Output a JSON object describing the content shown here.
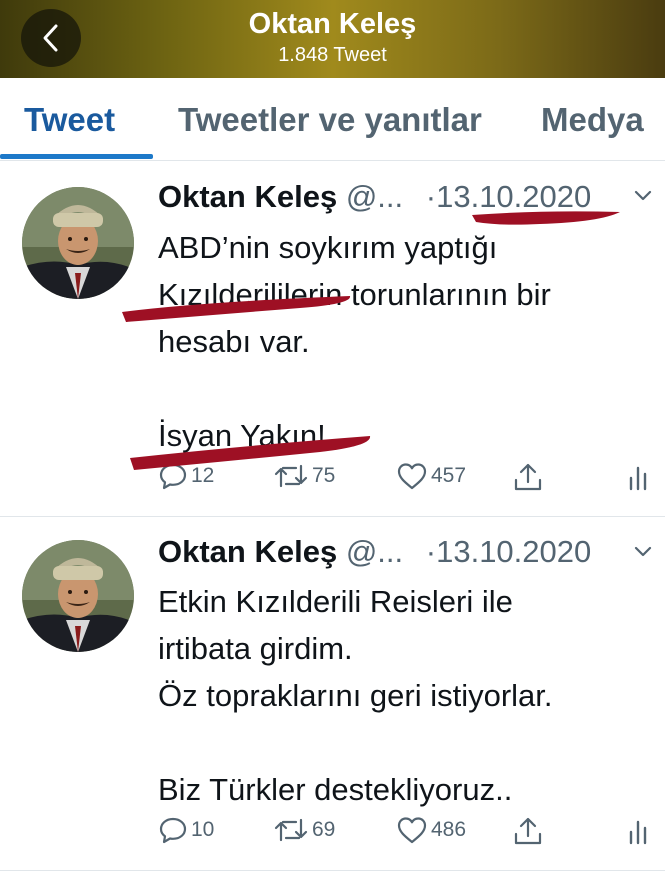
{
  "header": {
    "title": "Oktan Keleş",
    "subtitle": "1.848 Tweet",
    "back_icon": "chevron-left-icon"
  },
  "tabs": [
    {
      "label": "Tweet",
      "active": true
    },
    {
      "label": "Tweetler ve yanıtlar",
      "active": false
    },
    {
      "label": "Medya",
      "active": false
    }
  ],
  "tweets": [
    {
      "author": "Oktan Keleş",
      "handle": "@...",
      "date_sep": "·",
      "date": "13.10.2020",
      "lines": [
        "ABD’nin soykırım yaptığı",
        "Kızılderililerin torunlarının bir",
        "hesabı var.",
        "",
        "İsyan Yakın!"
      ],
      "replies": "12",
      "retweets": "75",
      "likes": "457"
    },
    {
      "author": "Oktan Keleş",
      "handle": "@...",
      "date_sep": "·",
      "date": "13.10.2020",
      "lines": [
        "Etkin Kızılderili Reisleri ile",
        "irtibata girdim.",
        "Öz topraklarını geri istiyorlar.",
        "",
        "Biz Türkler destekliyoruz.."
      ],
      "replies": "10",
      "retweets": "69",
      "likes": "486"
    }
  ],
  "colors": {
    "accent": "#1d79c9",
    "annotation_marker": "#9e1024",
    "secondary_text": "#536471"
  }
}
